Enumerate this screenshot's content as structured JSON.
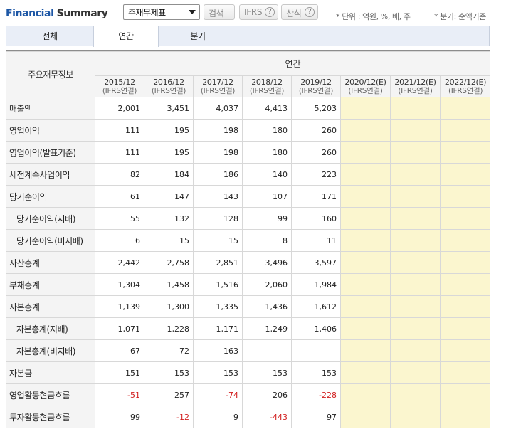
{
  "header": {
    "title_part1": "Financial",
    "title_part2": "Summary",
    "select_value": "주재무제표",
    "search_label": "검색",
    "ifrs_label": "IFRS",
    "formula_label": "산식",
    "help_glyph": "?",
    "unit_note": "* 단위 : 억원, %, 배, 주",
    "quarter_note": "* 분기: 순액기준"
  },
  "tabs": {
    "all": "전체",
    "annual": "연간",
    "quarter": "분기"
  },
  "table": {
    "corner_label": "주요재무정보",
    "group_label": "연간",
    "columns": [
      {
        "period": "2015/12",
        "basis": "(IFRS연결)"
      },
      {
        "period": "2016/12",
        "basis": "(IFRS연결)"
      },
      {
        "period": "2017/12",
        "basis": "(IFRS연결)"
      },
      {
        "period": "2018/12",
        "basis": "(IFRS연결)"
      },
      {
        "period": "2019/12",
        "basis": "(IFRS연결)"
      },
      {
        "period": "2020/12(E)",
        "basis": "(IFRS연결)"
      },
      {
        "period": "2021/12(E)",
        "basis": "(IFRS연결)"
      },
      {
        "period": "2022/12(E)",
        "basis": "(IFRS연결)"
      }
    ],
    "rows": [
      {
        "label": "매출액",
        "values": [
          "2,001",
          "3,451",
          "4,037",
          "4,413",
          "5,203",
          "",
          "",
          ""
        ]
      },
      {
        "label": "영업이익",
        "values": [
          "111",
          "195",
          "198",
          "180",
          "260",
          "",
          "",
          ""
        ]
      },
      {
        "label": "영업이익(발표기준)",
        "values": [
          "111",
          "195",
          "198",
          "180",
          "260",
          "",
          "",
          ""
        ]
      },
      {
        "label": "세전계속사업이익",
        "values": [
          "82",
          "184",
          "186",
          "140",
          "223",
          "",
          "",
          ""
        ]
      },
      {
        "label": "당기순이익",
        "values": [
          "61",
          "147",
          "143",
          "107",
          "171",
          "",
          "",
          ""
        ]
      },
      {
        "label": "당기순이익(지배)",
        "values": [
          "55",
          "132",
          "128",
          "99",
          "160",
          "",
          "",
          ""
        ]
      },
      {
        "label": "당기순이익(비지배)",
        "values": [
          "6",
          "15",
          "15",
          "8",
          "11",
          "",
          "",
          ""
        ]
      },
      {
        "label": "자산총계",
        "values": [
          "2,442",
          "2,758",
          "2,851",
          "3,496",
          "3,597",
          "",
          "",
          ""
        ]
      },
      {
        "label": "부채총계",
        "values": [
          "1,304",
          "1,458",
          "1,516",
          "2,060",
          "1,984",
          "",
          "",
          ""
        ]
      },
      {
        "label": "자본총계",
        "values": [
          "1,139",
          "1,300",
          "1,335",
          "1,436",
          "1,612",
          "",
          "",
          ""
        ]
      },
      {
        "label": "자본총계(지배)",
        "values": [
          "1,071",
          "1,228",
          "1,171",
          "1,249",
          "1,406",
          "",
          "",
          ""
        ]
      },
      {
        "label": "자본총계(비지배)",
        "values": [
          "67",
          "72",
          "163",
          "",
          "",
          "",
          "",
          ""
        ]
      },
      {
        "label": "자본금",
        "values": [
          "151",
          "153",
          "153",
          "153",
          "153",
          "",
          "",
          ""
        ]
      },
      {
        "label": "영업활동현금흐름",
        "values": [
          "-51",
          "257",
          "-74",
          "206",
          "-228",
          "",
          "",
          ""
        ]
      },
      {
        "label": "투자활동현금흐름",
        "values": [
          "99",
          "-12",
          "9",
          "-443",
          "97",
          "",
          "",
          ""
        ]
      }
    ]
  },
  "colors": {
    "title_accent": "#1c56a5",
    "negative": "#d21f1f",
    "estimate_fill": "#fbf6cf"
  }
}
